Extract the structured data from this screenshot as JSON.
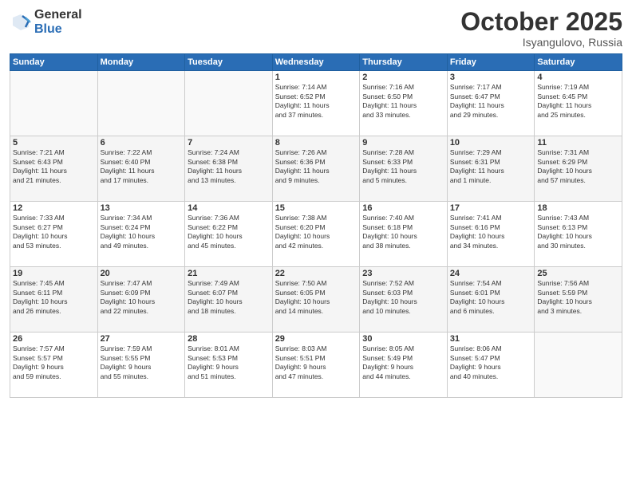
{
  "header": {
    "logo_general": "General",
    "logo_blue": "Blue",
    "month": "October 2025",
    "location": "Isyangulovo, Russia"
  },
  "weekdays": [
    "Sunday",
    "Monday",
    "Tuesday",
    "Wednesday",
    "Thursday",
    "Friday",
    "Saturday"
  ],
  "rows": [
    [
      {
        "day": "",
        "info": ""
      },
      {
        "day": "",
        "info": ""
      },
      {
        "day": "",
        "info": ""
      },
      {
        "day": "1",
        "info": "Sunrise: 7:14 AM\nSunset: 6:52 PM\nDaylight: 11 hours\nand 37 minutes."
      },
      {
        "day": "2",
        "info": "Sunrise: 7:16 AM\nSunset: 6:50 PM\nDaylight: 11 hours\nand 33 minutes."
      },
      {
        "day": "3",
        "info": "Sunrise: 7:17 AM\nSunset: 6:47 PM\nDaylight: 11 hours\nand 29 minutes."
      },
      {
        "day": "4",
        "info": "Sunrise: 7:19 AM\nSunset: 6:45 PM\nDaylight: 11 hours\nand 25 minutes."
      }
    ],
    [
      {
        "day": "5",
        "info": "Sunrise: 7:21 AM\nSunset: 6:43 PM\nDaylight: 11 hours\nand 21 minutes."
      },
      {
        "day": "6",
        "info": "Sunrise: 7:22 AM\nSunset: 6:40 PM\nDaylight: 11 hours\nand 17 minutes."
      },
      {
        "day": "7",
        "info": "Sunrise: 7:24 AM\nSunset: 6:38 PM\nDaylight: 11 hours\nand 13 minutes."
      },
      {
        "day": "8",
        "info": "Sunrise: 7:26 AM\nSunset: 6:36 PM\nDaylight: 11 hours\nand 9 minutes."
      },
      {
        "day": "9",
        "info": "Sunrise: 7:28 AM\nSunset: 6:33 PM\nDaylight: 11 hours\nand 5 minutes."
      },
      {
        "day": "10",
        "info": "Sunrise: 7:29 AM\nSunset: 6:31 PM\nDaylight: 11 hours\nand 1 minute."
      },
      {
        "day": "11",
        "info": "Sunrise: 7:31 AM\nSunset: 6:29 PM\nDaylight: 10 hours\nand 57 minutes."
      }
    ],
    [
      {
        "day": "12",
        "info": "Sunrise: 7:33 AM\nSunset: 6:27 PM\nDaylight: 10 hours\nand 53 minutes."
      },
      {
        "day": "13",
        "info": "Sunrise: 7:34 AM\nSunset: 6:24 PM\nDaylight: 10 hours\nand 49 minutes."
      },
      {
        "day": "14",
        "info": "Sunrise: 7:36 AM\nSunset: 6:22 PM\nDaylight: 10 hours\nand 45 minutes."
      },
      {
        "day": "15",
        "info": "Sunrise: 7:38 AM\nSunset: 6:20 PM\nDaylight: 10 hours\nand 42 minutes."
      },
      {
        "day": "16",
        "info": "Sunrise: 7:40 AM\nSunset: 6:18 PM\nDaylight: 10 hours\nand 38 minutes."
      },
      {
        "day": "17",
        "info": "Sunrise: 7:41 AM\nSunset: 6:16 PM\nDaylight: 10 hours\nand 34 minutes."
      },
      {
        "day": "18",
        "info": "Sunrise: 7:43 AM\nSunset: 6:13 PM\nDaylight: 10 hours\nand 30 minutes."
      }
    ],
    [
      {
        "day": "19",
        "info": "Sunrise: 7:45 AM\nSunset: 6:11 PM\nDaylight: 10 hours\nand 26 minutes."
      },
      {
        "day": "20",
        "info": "Sunrise: 7:47 AM\nSunset: 6:09 PM\nDaylight: 10 hours\nand 22 minutes."
      },
      {
        "day": "21",
        "info": "Sunrise: 7:49 AM\nSunset: 6:07 PM\nDaylight: 10 hours\nand 18 minutes."
      },
      {
        "day": "22",
        "info": "Sunrise: 7:50 AM\nSunset: 6:05 PM\nDaylight: 10 hours\nand 14 minutes."
      },
      {
        "day": "23",
        "info": "Sunrise: 7:52 AM\nSunset: 6:03 PM\nDaylight: 10 hours\nand 10 minutes."
      },
      {
        "day": "24",
        "info": "Sunrise: 7:54 AM\nSunset: 6:01 PM\nDaylight: 10 hours\nand 6 minutes."
      },
      {
        "day": "25",
        "info": "Sunrise: 7:56 AM\nSunset: 5:59 PM\nDaylight: 10 hours\nand 3 minutes."
      }
    ],
    [
      {
        "day": "26",
        "info": "Sunrise: 7:57 AM\nSunset: 5:57 PM\nDaylight: 9 hours\nand 59 minutes."
      },
      {
        "day": "27",
        "info": "Sunrise: 7:59 AM\nSunset: 5:55 PM\nDaylight: 9 hours\nand 55 minutes."
      },
      {
        "day": "28",
        "info": "Sunrise: 8:01 AM\nSunset: 5:53 PM\nDaylight: 9 hours\nand 51 minutes."
      },
      {
        "day": "29",
        "info": "Sunrise: 8:03 AM\nSunset: 5:51 PM\nDaylight: 9 hours\nand 47 minutes."
      },
      {
        "day": "30",
        "info": "Sunrise: 8:05 AM\nSunset: 5:49 PM\nDaylight: 9 hours\nand 44 minutes."
      },
      {
        "day": "31",
        "info": "Sunrise: 8:06 AM\nSunset: 5:47 PM\nDaylight: 9 hours\nand 40 minutes."
      },
      {
        "day": "",
        "info": ""
      }
    ]
  ]
}
